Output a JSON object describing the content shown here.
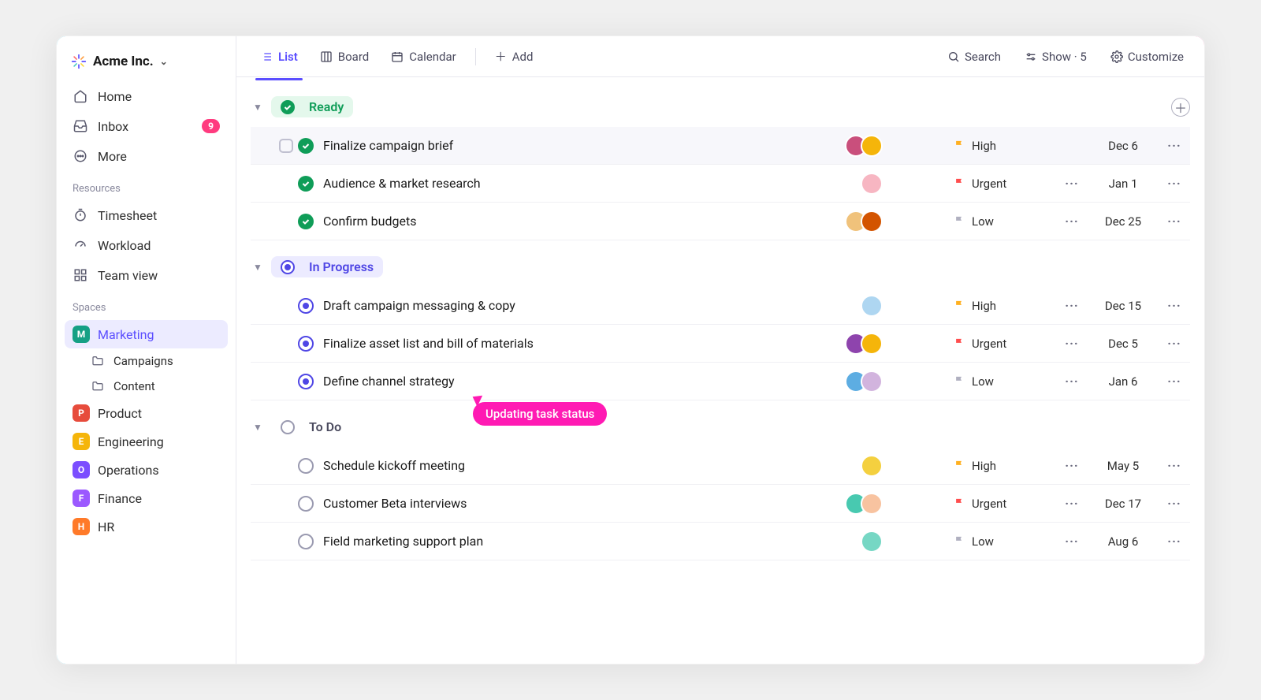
{
  "workspace": {
    "name": "Acme Inc."
  },
  "nav": {
    "home": "Home",
    "inbox": "Inbox",
    "inbox_badge": "9",
    "more": "More"
  },
  "sections": {
    "resources": "Resources",
    "spaces": "Spaces"
  },
  "resources": {
    "timesheet": "Timesheet",
    "workload": "Workload",
    "teamview": "Team view"
  },
  "spaces": [
    {
      "letter": "M",
      "color": "#16a085",
      "label": "Marketing",
      "active": true,
      "folders": [
        "Campaigns",
        "Content"
      ]
    },
    {
      "letter": "P",
      "color": "#e74c3c",
      "label": "Product"
    },
    {
      "letter": "E",
      "color": "#f5b50a",
      "label": "Engineering"
    },
    {
      "letter": "O",
      "color": "#7b4eff",
      "label": "Operations"
    },
    {
      "letter": "F",
      "color": "#9b59ff",
      "label": "Finance"
    },
    {
      "letter": "H",
      "color": "#ff7a29",
      "label": "HR"
    }
  ],
  "views": {
    "list": "List",
    "board": "Board",
    "calendar": "Calendar",
    "add": "Add"
  },
  "toolbar": {
    "search": "Search",
    "show": "Show · 5",
    "customize": "Customize"
  },
  "groups": [
    {
      "key": "ready",
      "label": "Ready",
      "style": "ready",
      "show_add": true,
      "tasks": [
        {
          "name": "Finalize campaign brief",
          "avatars": [
            "#c94f7c",
            "#f5b50a"
          ],
          "priority": "High",
          "pclass": "high",
          "date": "Dec 6",
          "show_cb": true,
          "ellipsis": false,
          "hover": true
        },
        {
          "name": "Audience & market research",
          "avatars": [
            "#f7b6c2"
          ],
          "priority": "Urgent",
          "pclass": "urgent",
          "date": "Jan 1",
          "ellipsis": true
        },
        {
          "name": "Confirm budgets",
          "avatars": [
            "#f0c27b",
            "#d35400"
          ],
          "priority": "Low",
          "pclass": "low",
          "date": "Dec 25",
          "ellipsis": true
        }
      ]
    },
    {
      "key": "progress",
      "label": "In Progress",
      "style": "progress",
      "tasks": [
        {
          "name": "Draft campaign messaging & copy",
          "avatars": [
            "#aed6f1"
          ],
          "priority": "High",
          "pclass": "high",
          "date": "Dec 15",
          "ellipsis": true
        },
        {
          "name": "Finalize asset list and bill of materials",
          "avatars": [
            "#8e44ad",
            "#f5b50a"
          ],
          "priority": "Urgent",
          "pclass": "urgent",
          "date": "Dec 5",
          "ellipsis": true
        },
        {
          "name": "Define channel strategy",
          "avatars": [
            "#5dade2",
            "#d2b4de"
          ],
          "priority": "Low",
          "pclass": "low",
          "date": "Jan 6",
          "ellipsis": true
        }
      ]
    },
    {
      "key": "todo",
      "label": "To Do",
      "style": "todo",
      "tasks": [
        {
          "name": "Schedule kickoff meeting",
          "avatars": [
            "#f4d03f"
          ],
          "priority": "High",
          "pclass": "high",
          "date": "May 5",
          "ellipsis": true
        },
        {
          "name": "Customer Beta interviews",
          "avatars": [
            "#48c9b0",
            "#f8c3a0"
          ],
          "priority": "Urgent",
          "pclass": "urgent",
          "date": "Dec 17",
          "ellipsis": true
        },
        {
          "name": "Field marketing support plan",
          "avatars": [
            "#76d7c4"
          ],
          "priority": "Low",
          "pclass": "low",
          "date": "Aug 6",
          "ellipsis": true
        }
      ]
    }
  ],
  "callout": "Updating task status"
}
